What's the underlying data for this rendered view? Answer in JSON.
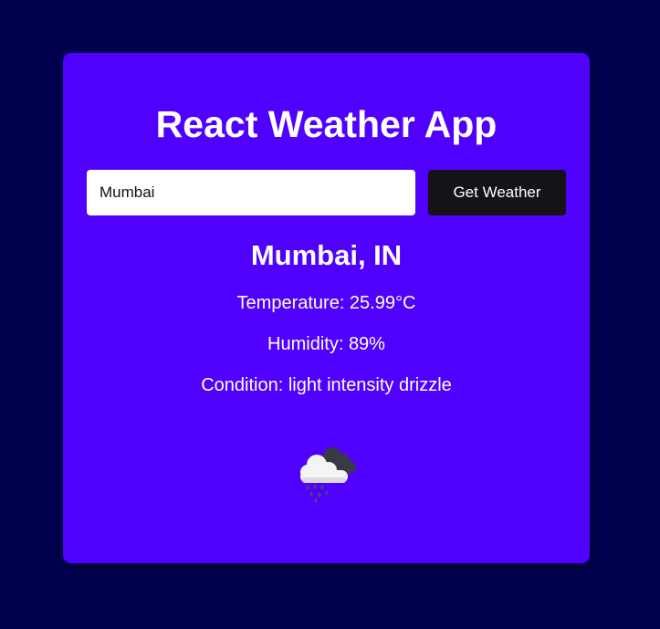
{
  "app": {
    "title": "React Weather App"
  },
  "search": {
    "value": "Mumbai",
    "button_label": "Get Weather"
  },
  "weather": {
    "location": "Mumbai, IN",
    "temperature_text": "Temperature: 25.99°C",
    "humidity_text": "Humidity: 89%",
    "condition_text": "Condition: light intensity drizzle",
    "icon": "drizzle-cloud-icon"
  },
  "colors": {
    "page_background": "#01004f",
    "card_background": "#5001fe",
    "button_background": "#151317",
    "text": "#ffffff"
  }
}
